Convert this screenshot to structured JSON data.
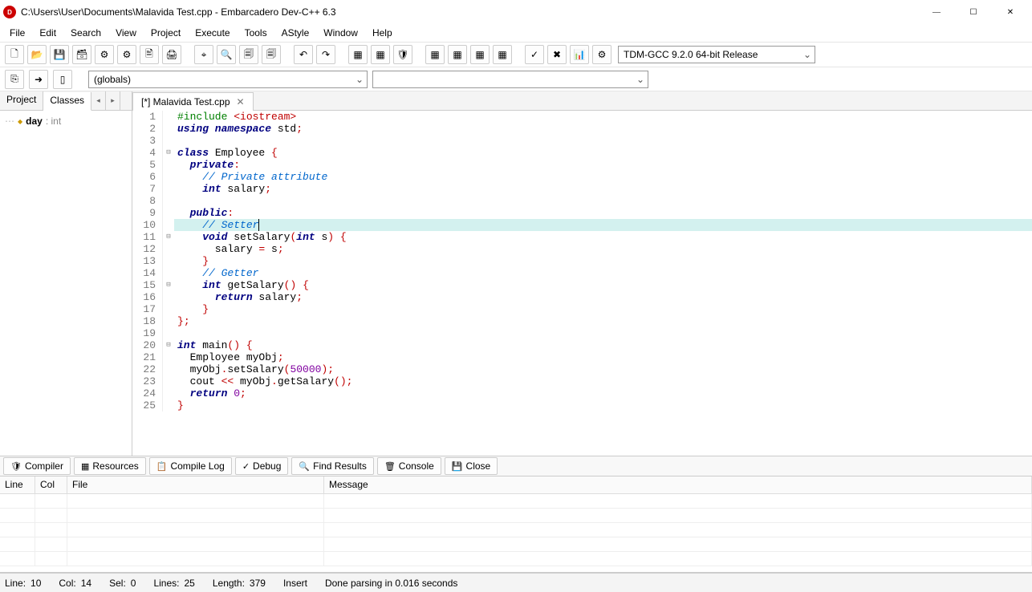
{
  "title": "C:\\Users\\User\\Documents\\Malavida Test.cpp - Embarcadero Dev-C++ 6.3",
  "menu": [
    "File",
    "Edit",
    "Search",
    "View",
    "Project",
    "Execute",
    "Tools",
    "AStyle",
    "Window",
    "Help"
  ],
  "compiler_sel": "TDM-GCC 9.2.0 64-bit Release",
  "globals": "(globals)",
  "side_tabs": {
    "a": "Project",
    "b": "Classes"
  },
  "class_tree": {
    "name": "day",
    "type": ": int"
  },
  "file_tab": "[*] Malavida Test.cpp",
  "code": [
    {
      "n": 1,
      "f": "",
      "seg": [
        {
          "c": "pp",
          "t": "#include "
        },
        {
          "c": "ppv",
          "t": "<iostream>"
        }
      ]
    },
    {
      "n": 2,
      "f": "",
      "seg": [
        {
          "c": "kw",
          "t": "using namespace"
        },
        {
          "c": "",
          "t": " std"
        },
        {
          "c": "op",
          "t": ";"
        }
      ]
    },
    {
      "n": 3,
      "f": "",
      "seg": []
    },
    {
      "n": 4,
      "f": "⊟",
      "seg": [
        {
          "c": "kw",
          "t": "class"
        },
        {
          "c": "",
          "t": " Employee "
        },
        {
          "c": "br",
          "t": "{"
        }
      ]
    },
    {
      "n": 5,
      "f": "",
      "seg": [
        {
          "c": "",
          "t": "  "
        },
        {
          "c": "kw",
          "t": "private"
        },
        {
          "c": "op",
          "t": ":"
        }
      ]
    },
    {
      "n": 6,
      "f": "",
      "seg": [
        {
          "c": "",
          "t": "    "
        },
        {
          "c": "cm",
          "t": "// Private attribute"
        }
      ]
    },
    {
      "n": 7,
      "f": "",
      "seg": [
        {
          "c": "",
          "t": "    "
        },
        {
          "c": "kw",
          "t": "int"
        },
        {
          "c": "",
          "t": " salary"
        },
        {
          "c": "op",
          "t": ";"
        }
      ]
    },
    {
      "n": 8,
      "f": "",
      "seg": []
    },
    {
      "n": 9,
      "f": "",
      "seg": [
        {
          "c": "",
          "t": "  "
        },
        {
          "c": "kw",
          "t": "public"
        },
        {
          "c": "op",
          "t": ":"
        }
      ]
    },
    {
      "n": 10,
      "f": "",
      "hl": true,
      "seg": [
        {
          "c": "",
          "t": "    "
        },
        {
          "c": "cm",
          "t": "// Setter"
        }
      ],
      "cursor": true
    },
    {
      "n": 11,
      "f": "⊟",
      "seg": [
        {
          "c": "",
          "t": "    "
        },
        {
          "c": "kw",
          "t": "void"
        },
        {
          "c": "",
          "t": " setSalary"
        },
        {
          "c": "br",
          "t": "("
        },
        {
          "c": "kw",
          "t": "int"
        },
        {
          "c": "",
          "t": " s"
        },
        {
          "c": "br",
          "t": ")"
        },
        {
          "c": "",
          "t": " "
        },
        {
          "c": "br",
          "t": "{"
        }
      ]
    },
    {
      "n": 12,
      "f": "",
      "seg": [
        {
          "c": "",
          "t": "      salary "
        },
        {
          "c": "op",
          "t": "="
        },
        {
          "c": "",
          "t": " s"
        },
        {
          "c": "op",
          "t": ";"
        }
      ]
    },
    {
      "n": 13,
      "f": "",
      "seg": [
        {
          "c": "",
          "t": "    "
        },
        {
          "c": "br",
          "t": "}"
        }
      ]
    },
    {
      "n": 14,
      "f": "",
      "seg": [
        {
          "c": "",
          "t": "    "
        },
        {
          "c": "cm",
          "t": "// Getter"
        }
      ]
    },
    {
      "n": 15,
      "f": "⊟",
      "seg": [
        {
          "c": "",
          "t": "    "
        },
        {
          "c": "kw",
          "t": "int"
        },
        {
          "c": "",
          "t": " getSalary"
        },
        {
          "c": "br",
          "t": "()"
        },
        {
          "c": "",
          "t": " "
        },
        {
          "c": "br",
          "t": "{"
        }
      ]
    },
    {
      "n": 16,
      "f": "",
      "seg": [
        {
          "c": "",
          "t": "      "
        },
        {
          "c": "kw",
          "t": "return"
        },
        {
          "c": "",
          "t": " salary"
        },
        {
          "c": "op",
          "t": ";"
        }
      ]
    },
    {
      "n": 17,
      "f": "",
      "seg": [
        {
          "c": "",
          "t": "    "
        },
        {
          "c": "br",
          "t": "}"
        }
      ]
    },
    {
      "n": 18,
      "f": "",
      "seg": [
        {
          "c": "br",
          "t": "}"
        },
        {
          "c": "op",
          "t": ";"
        }
      ]
    },
    {
      "n": 19,
      "f": "",
      "seg": []
    },
    {
      "n": 20,
      "f": "⊟",
      "seg": [
        {
          "c": "kw",
          "t": "int"
        },
        {
          "c": "",
          "t": " main"
        },
        {
          "c": "br",
          "t": "()"
        },
        {
          "c": "",
          "t": " "
        },
        {
          "c": "br",
          "t": "{"
        }
      ]
    },
    {
      "n": 21,
      "f": "",
      "seg": [
        {
          "c": "",
          "t": "  Employee myObj"
        },
        {
          "c": "op",
          "t": ";"
        }
      ]
    },
    {
      "n": 22,
      "f": "",
      "seg": [
        {
          "c": "",
          "t": "  myObj"
        },
        {
          "c": "op",
          "t": "."
        },
        {
          "c": "",
          "t": "setSalary"
        },
        {
          "c": "br",
          "t": "("
        },
        {
          "c": "num",
          "t": "50000"
        },
        {
          "c": "br",
          "t": ")"
        },
        {
          "c": "op",
          "t": ";"
        }
      ]
    },
    {
      "n": 23,
      "f": "",
      "seg": [
        {
          "c": "",
          "t": "  cout "
        },
        {
          "c": "op",
          "t": "<<"
        },
        {
          "c": "",
          "t": " myObj"
        },
        {
          "c": "op",
          "t": "."
        },
        {
          "c": "",
          "t": "getSalary"
        },
        {
          "c": "br",
          "t": "()"
        },
        {
          "c": "op",
          "t": ";"
        }
      ]
    },
    {
      "n": 24,
      "f": "",
      "seg": [
        {
          "c": "",
          "t": "  "
        },
        {
          "c": "kw",
          "t": "return"
        },
        {
          "c": "",
          "t": " "
        },
        {
          "c": "num",
          "t": "0"
        },
        {
          "c": "op",
          "t": ";"
        }
      ]
    },
    {
      "n": 25,
      "f": "",
      "seg": [
        {
          "c": "br",
          "t": "}"
        }
      ]
    }
  ],
  "bottom_tabs": [
    {
      "icon": "🛡",
      "label": "Compiler"
    },
    {
      "icon": "▦",
      "label": "Resources"
    },
    {
      "icon": "📋",
      "label": "Compile Log"
    },
    {
      "icon": "✓",
      "label": "Debug"
    },
    {
      "icon": "🔍",
      "label": "Find Results"
    },
    {
      "icon": "🗑",
      "label": "Console"
    },
    {
      "icon": "💾",
      "label": "Close"
    }
  ],
  "grid_head": {
    "line": "Line",
    "col": "Col",
    "file": "File",
    "msg": "Message"
  },
  "status": {
    "line_l": "Line:",
    "line_v": "10",
    "col_l": "Col:",
    "col_v": "14",
    "sel_l": "Sel:",
    "sel_v": "0",
    "lines_l": "Lines:",
    "lines_v": "25",
    "len_l": "Length:",
    "len_v": "379",
    "ins": "Insert",
    "msg": "Done parsing in 0.016 seconds"
  },
  "tool_icons": [
    "🗋",
    "📂",
    "💾",
    "🗃",
    "⚙",
    "⚙",
    "🖹",
    "🖨",
    "",
    "⌖",
    "🔍",
    "🗐",
    "🗐",
    "",
    "↶",
    "↷",
    "",
    "▦",
    "▦",
    "🛡",
    "",
    "▦",
    "▦",
    "▦",
    "▦",
    "",
    "✓",
    "✖",
    "📊",
    "⚙"
  ]
}
